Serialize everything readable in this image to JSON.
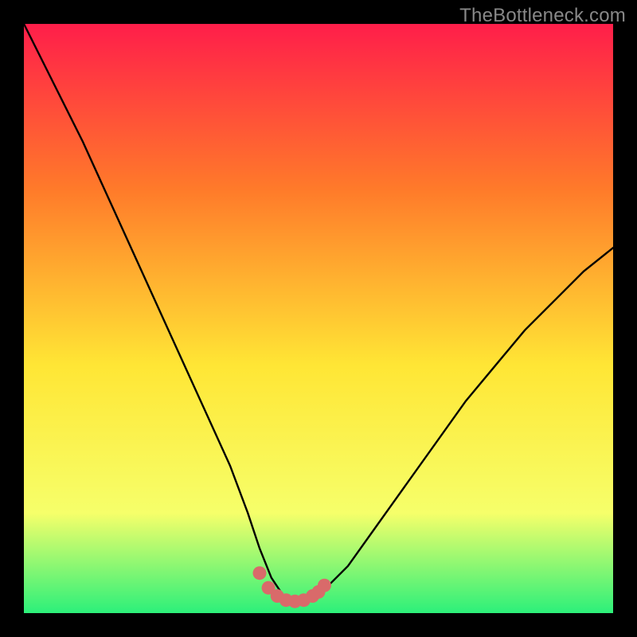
{
  "watermark": "TheBottleneck.com",
  "colors": {
    "frame": "#000000",
    "gradient_top": "#ff1e4a",
    "gradient_mid1": "#ff7a2a",
    "gradient_mid2": "#ffe635",
    "gradient_mid3": "#f6ff6a",
    "gradient_bottom": "#2cf07a",
    "curve": "#000000",
    "marker": "#d96a6a"
  },
  "chart_data": {
    "type": "line",
    "title": "",
    "xlabel": "",
    "ylabel": "",
    "xlim": [
      0,
      100
    ],
    "ylim": [
      0,
      100
    ],
    "series": [
      {
        "name": "bottleneck-curve",
        "x": [
          0,
          5,
          10,
          15,
          20,
          25,
          30,
          35,
          38,
          40,
          42,
          44,
          46,
          48,
          50,
          55,
          60,
          65,
          70,
          75,
          80,
          85,
          90,
          95,
          100
        ],
        "y": [
          100,
          90,
          80,
          69,
          58,
          47,
          36,
          25,
          17,
          11,
          6,
          3,
          2,
          2,
          3,
          8,
          15,
          22,
          29,
          36,
          42,
          48,
          53,
          58,
          62
        ]
      }
    ],
    "markers": {
      "name": "highlight-points",
      "x": [
        40,
        41.5,
        43,
        44.5,
        46,
        47.5,
        49,
        50,
        51
      ],
      "y": [
        6.8,
        4.3,
        2.9,
        2.2,
        2.0,
        2.2,
        2.9,
        3.6,
        4.7
      ]
    }
  }
}
